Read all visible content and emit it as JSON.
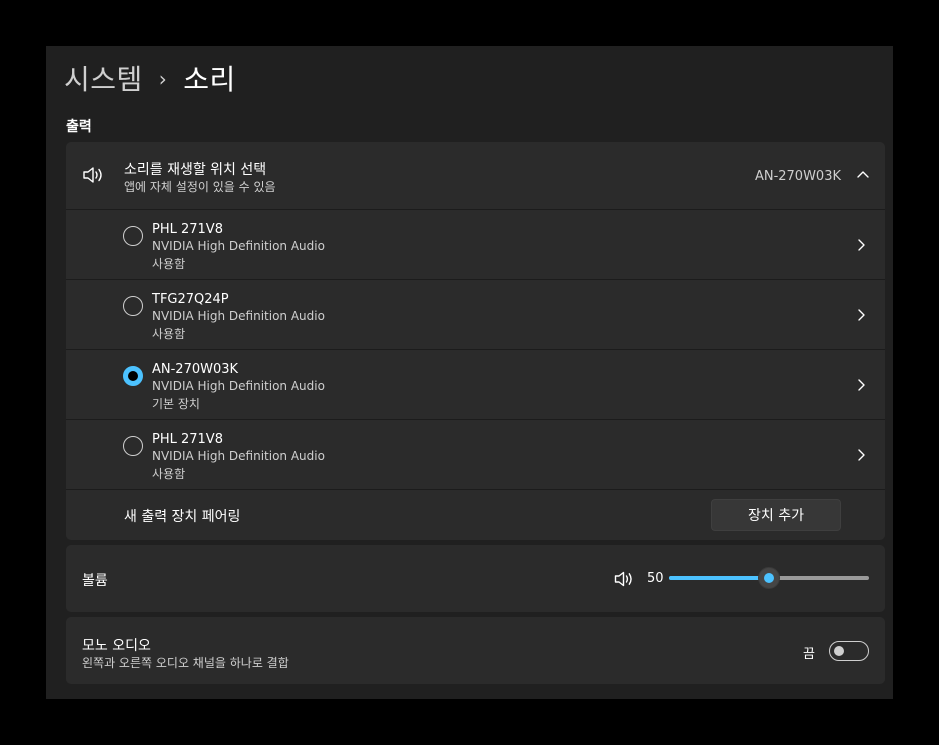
{
  "breadcrumb": {
    "parent": "시스템",
    "separator": "›",
    "current": "소리"
  },
  "output": {
    "section_title": "출력",
    "header": {
      "title": "소리를 재생할 위치 선택",
      "subtitle": "앱에 자체 설정이 있을 수 있음",
      "selected_value": "AN-270W03K",
      "icon": "speaker-icon"
    },
    "devices": [
      {
        "name": "PHL 271V8",
        "driver": "NVIDIA High Definition Audio",
        "status": "사용함",
        "selected": false
      },
      {
        "name": "TFG27Q24P",
        "driver": "NVIDIA High Definition Audio",
        "status": "사용함",
        "selected": false
      },
      {
        "name": "AN-270W03K",
        "driver": "NVIDIA High Definition Audio",
        "status": "기본 장치",
        "selected": true
      },
      {
        "name": "PHL 271V8",
        "driver": "NVIDIA High Definition Audio",
        "status": "사용함",
        "selected": false
      }
    ],
    "pair": {
      "label": "새 출력 장치 페어링",
      "button": "장치 추가"
    }
  },
  "volume": {
    "label": "볼륨",
    "value": "50",
    "level_percent": 50
  },
  "mono": {
    "title": "모노 오디오",
    "subtitle": "왼쪽과 오른쪽 오디오 채널을 하나로 결합",
    "state": "끔",
    "on": false
  },
  "colors": {
    "accent": "#4cc2ff",
    "card": "#2b2b2b",
    "window": "#202020"
  }
}
